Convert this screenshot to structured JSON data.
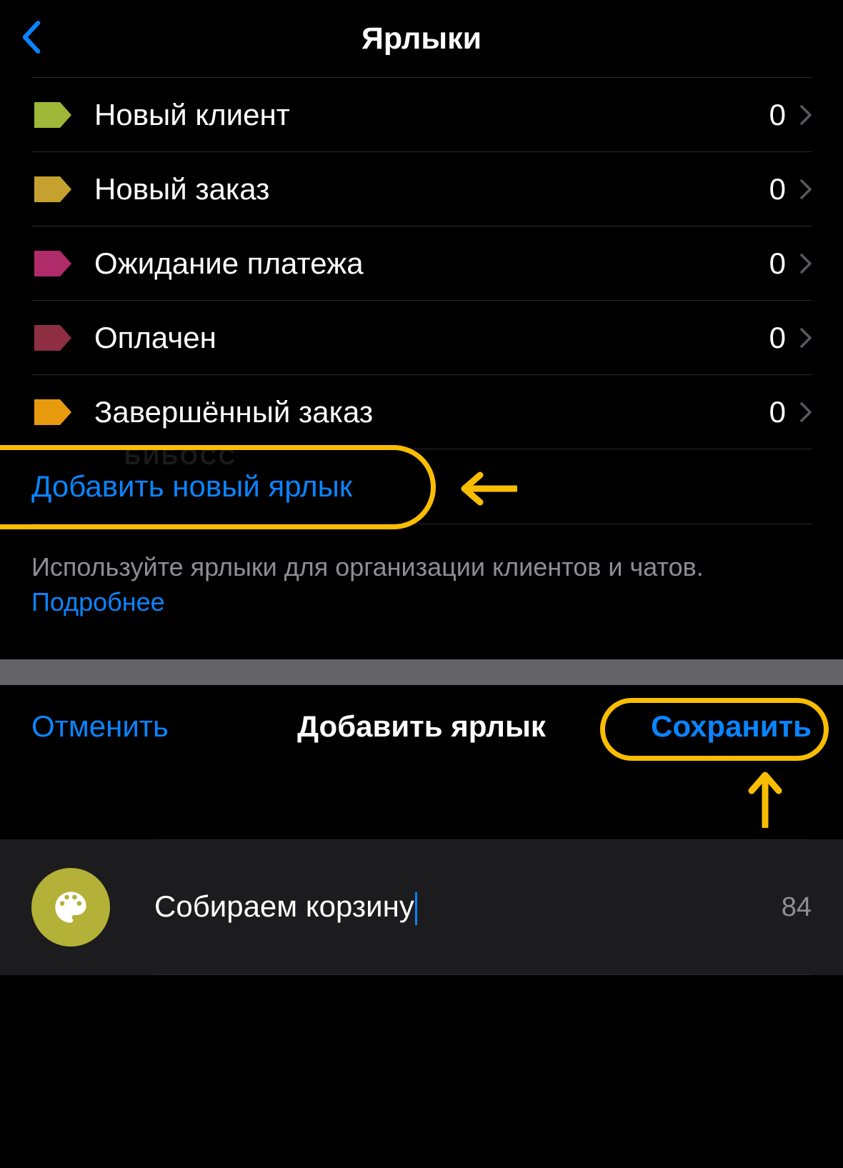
{
  "header": {
    "title": "Ярлыки"
  },
  "labels": [
    {
      "name": "Новый клиент",
      "count": "0",
      "color": "#a0b738"
    },
    {
      "name": "Новый заказ",
      "count": "0",
      "color": "#c5a230"
    },
    {
      "name": "Ожидание платежа",
      "count": "0",
      "color": "#b02b6a"
    },
    {
      "name": "Оплачен",
      "count": "0",
      "color": "#8e2e42"
    },
    {
      "name": "Завершённый заказ",
      "count": "0",
      "color": "#e89a0e"
    }
  ],
  "add_label": "Добавить новый ярлык",
  "watermark": "БИБОСС",
  "help": {
    "text": "Используйте ярлыки для организации клиентов и чатов. ",
    "link": "Подробнее"
  },
  "dialog": {
    "cancel": "Отменить",
    "title": "Добавить ярлык",
    "save": "Сохранить",
    "input_value": "Собираем корзину",
    "char_remaining": "84",
    "palette_color": "#b3b137"
  }
}
